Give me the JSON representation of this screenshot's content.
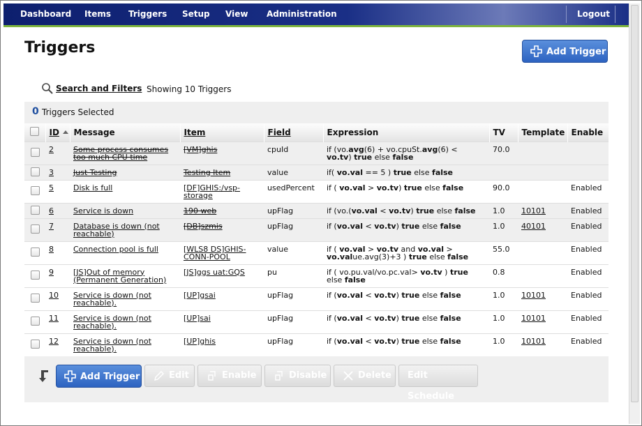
{
  "nav": {
    "items": [
      "Dashboard",
      "Items",
      "Triggers",
      "Setup",
      "View",
      "Administration"
    ],
    "logout": "Logout"
  },
  "page": {
    "title": "Triggers",
    "add_trigger": "Add Trigger",
    "search_filters": "Search and Filters",
    "showing": "Showing 10 Triggers",
    "selected_count": "0",
    "selected_label": "Triggers Selected"
  },
  "table": {
    "headers": [
      "ID",
      "Message",
      "Item",
      "Field",
      "Expression",
      "TV",
      "Template",
      "Enable"
    ],
    "rows": [
      {
        "id": "2",
        "message": "Some process consumes too much CPU time",
        "item": "[VM]ghis",
        "field": "cpuId",
        "tv": "70.0",
        "template": "",
        "enable": ""
      },
      {
        "id": "3",
        "message": "Just Testing",
        "item": "Testing Item",
        "field": "value",
        "tv": "",
        "template": "",
        "enable": ""
      },
      {
        "id": "5",
        "message": "Disk is full",
        "item": "[DF]GHIS:/vsp-storage",
        "field": "usedPercent",
        "tv": "90.0",
        "template": "",
        "enable": "Enabled"
      },
      {
        "id": "6",
        "message": "Service is down",
        "item": "190 web",
        "field": "upFlag",
        "tv": "1.0",
        "template": "10101",
        "enable": "Enabled"
      },
      {
        "id": "7",
        "message": "Database is down (not reachable)",
        "item": "[DB]szmis",
        "field": "upFlag",
        "tv": "1.0",
        "template": "40101",
        "enable": "Enabled"
      },
      {
        "id": "8",
        "message": "Connection pool is full",
        "item": "[WLS8 DS]GHIS-CONN-POOL",
        "field": "value",
        "tv": "55.0",
        "template": "",
        "enable": "Enabled"
      },
      {
        "id": "9",
        "message": "[JS]Out of memory (Permanent Generation)",
        "item": "[JS]ggs uat:GQS",
        "field": "pu",
        "tv": "0.8",
        "template": "",
        "enable": "Enabled"
      },
      {
        "id": "10",
        "message": "Service is down (not reachable).",
        "item": "[UP]gsai",
        "field": "upFlag",
        "tv": "1.0",
        "template": "10101",
        "enable": "Enabled"
      },
      {
        "id": "11",
        "message": "Service is down (not reachable).",
        "item": "[UP]sai",
        "field": "upFlag",
        "tv": "1.0",
        "template": "10101",
        "enable": "Enabled"
      },
      {
        "id": "12",
        "message": "Service is down (not reachable).",
        "item": "[UP]ghis",
        "field": "upFlag",
        "tv": "1.0",
        "template": "10101",
        "enable": "Enabled"
      }
    ],
    "expr": {
      "if_vo": "if (vo.",
      "avg6": "avg",
      "plus_cpu": "(6) + vo.cpuSt.",
      "avg6b": "avg",
      "paren6": "(6) <",
      "vo_tv": "vo.tv",
      "close": ")",
      "true": "true",
      "else": "else",
      "false": "false",
      "if_paren": "if( ",
      "vo_val": "vo.val",
      "eq5": " == 5 )",
      "if_sp": "if ( ",
      "gt": " > ",
      "lt": " < ",
      "and": " and ",
      "vo_val2": "vo.val",
      "ue_avg": "ue.avg(3)+3 )",
      "if_pu": "if ( vo.pu.val/vo.pc.val> ",
      "close_sp": " )"
    }
  },
  "actions": {
    "add_trigger": "Add Trigger",
    "edit": "Edit",
    "enable": "Enable",
    "disable": "Disable",
    "delete": "Delete",
    "edit_schedule": "Edit Schedule"
  },
  "colors": {
    "nav": "#1a2f86",
    "accent": "#2d63c1",
    "rule": "#7fb53e"
  }
}
